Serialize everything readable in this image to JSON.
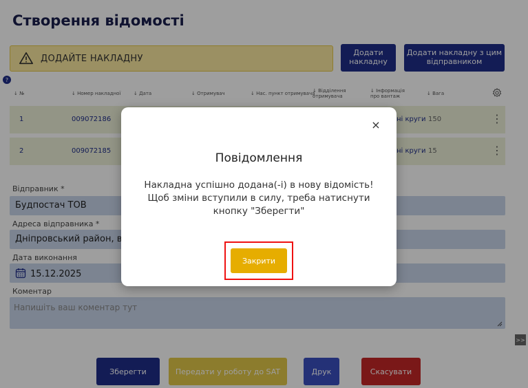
{
  "page": {
    "title": "Створення відомості"
  },
  "warning": {
    "text": "ДОДАЙТЕ НАКЛАДНУ",
    "icon": "warning-icon"
  },
  "header_buttons": {
    "add": "Додати накладну",
    "add_same_sender": "Додати накладну з цим відправником"
  },
  "help_badge": "?",
  "table": {
    "columns": [
      "№",
      "Номер накладної",
      "Дата",
      "Отримувач",
      "Нас. пункт отримувача",
      "Відділення отримувача",
      "Інформація про вантаж",
      "Вага"
    ],
    "rows": [
      {
        "num": "1",
        "number": "009072186",
        "cargo": "ні круги",
        "weight": "150"
      },
      {
        "num": "2",
        "number": "009072185",
        "cargo": "ні круги",
        "weight": "15"
      }
    ],
    "row_menu": "⋮"
  },
  "form": {
    "sender_label": "Відправник *",
    "sender_value": "Будпостач ТОВ",
    "address_label": "Адреса відправника *",
    "address_value": "Дніпровський район, вул",
    "date_label": "Дата виконання",
    "date_value": "15.12.2025",
    "comment_label": "Коментар",
    "comment_placeholder": "Напишіть ваш коментар тут"
  },
  "bottom_buttons": {
    "save": "Зберегти",
    "sat": "Передати у роботу до SAT",
    "print": "Друк",
    "cancel": "Скасувати"
  },
  "side_toggle": ">>",
  "modal": {
    "title": "Повідомлення",
    "line1": "Накладна успішно додана(-і) в нову відомість!",
    "line2": "Щоб зміни вступили в силу, треба натиснути",
    "line3": "кнопку \"Зберегти\"",
    "close_button": "Закрити",
    "close_icon": "×"
  },
  "colors": {
    "primary": "#1f2e8a",
    "warning_bg": "#fbe9a0",
    "modal_button": "#e6ad00",
    "cancel": "#c62828",
    "input_bg": "#c9d5ea",
    "highlight_frame": "#ee1111"
  }
}
